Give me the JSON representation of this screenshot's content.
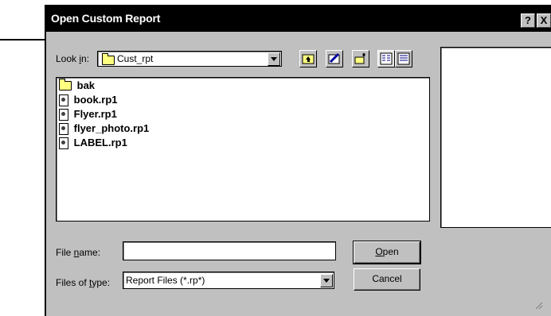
{
  "dialog": {
    "title": "Open Custom Report",
    "help_glyph": "?",
    "close_glyph": "X"
  },
  "look_in": {
    "label_prefix": "Look ",
    "label_accel": "i",
    "label_suffix": "n:",
    "value": "Cust_rpt",
    "icon": "folder-icon"
  },
  "toolbar": {
    "buttons": [
      "up-one-level-icon",
      "desktop-icon",
      "new-folder-icon",
      "list-view-icon",
      "details-view-icon"
    ]
  },
  "files": [
    {
      "name": "bak",
      "icon": "folder-icon"
    },
    {
      "name": "book.rp1",
      "icon": "report-file-icon"
    },
    {
      "name": "Flyer.rp1",
      "icon": "report-file-icon"
    },
    {
      "name": "flyer_photo.rp1",
      "icon": "report-file-icon"
    },
    {
      "name": "LABEL.rp1",
      "icon": "report-file-icon"
    }
  ],
  "file_name": {
    "label_prefix": "File ",
    "label_accel": "n",
    "label_suffix": "ame:",
    "value": ""
  },
  "file_type": {
    "label_prefix": "Files of ",
    "label_accel": "t",
    "label_suffix": "ype:",
    "value": "Report Files (*.rp*)"
  },
  "buttons": {
    "open_accel": "O",
    "open_rest": "pen",
    "cancel": "Cancel"
  },
  "colors": {
    "titlebar": "#000000",
    "face": "#c0c0c0",
    "folder": "#ffff80"
  }
}
